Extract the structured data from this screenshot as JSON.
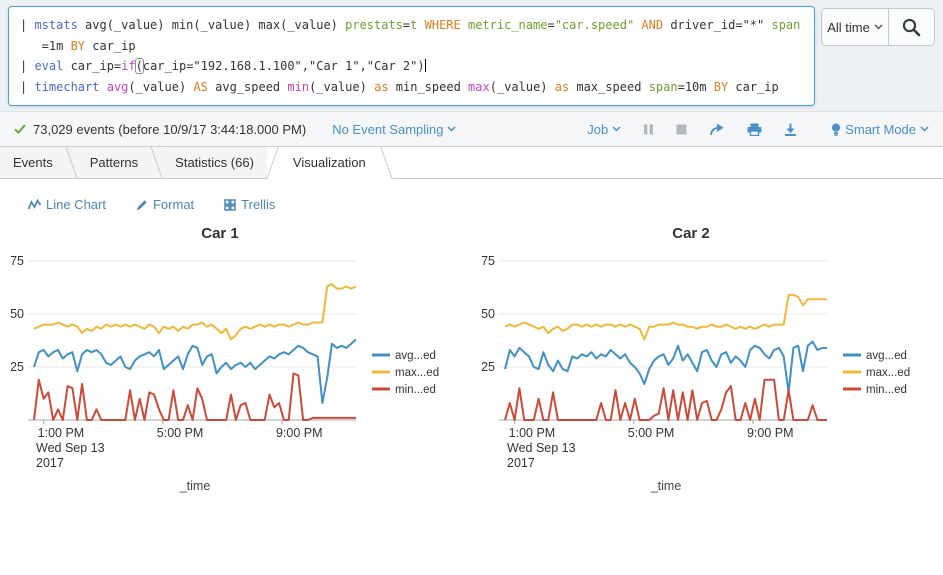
{
  "search": {
    "time_range_label": "All time",
    "query_lines": [
      [
        {
          "t": "| "
        },
        {
          "t": "mstats",
          "c": "cmd"
        },
        {
          "t": " avg(_value) min(_value) max(_value) "
        },
        {
          "t": "prestats",
          "c": "arg"
        },
        {
          "t": "="
        },
        {
          "t": "t",
          "c": "arg"
        },
        {
          "t": " "
        },
        {
          "t": "WHERE",
          "c": "kw"
        },
        {
          "t": " "
        },
        {
          "t": "metric_name",
          "c": "arg"
        },
        {
          "t": "="
        },
        {
          "t": "\"car.speed\"",
          "c": "arg"
        },
        {
          "t": " "
        },
        {
          "t": "AND",
          "c": "kw"
        },
        {
          "t": " driver_id=\"*\" "
        },
        {
          "t": "span",
          "c": "arg"
        }
      ],
      [
        {
          "t": "   =1m "
        },
        {
          "t": "BY",
          "c": "kw"
        },
        {
          "t": " car_ip"
        }
      ],
      [
        {
          "t": "| "
        },
        {
          "t": "eval",
          "c": "cmd"
        },
        {
          "t": " car_ip="
        },
        {
          "t": "if",
          "c": "fn"
        },
        {
          "t": "(",
          "c": "br"
        },
        {
          "t": "car_ip=\"192.168.1.100\",\"Car 1\",\"Car 2\")"
        },
        {
          "t": "",
          "c": "cursor"
        }
      ],
      [
        {
          "t": "| "
        },
        {
          "t": "timechart",
          "c": "cmd"
        },
        {
          "t": " "
        },
        {
          "t": "avg",
          "c": "fn"
        },
        {
          "t": "(_value) "
        },
        {
          "t": "AS",
          "c": "kw"
        },
        {
          "t": " avg_speed "
        },
        {
          "t": "min",
          "c": "fn"
        },
        {
          "t": "(_value) "
        },
        {
          "t": "as",
          "c": "kw"
        },
        {
          "t": " min_speed "
        },
        {
          "t": "max",
          "c": "fn"
        },
        {
          "t": "(_value) "
        },
        {
          "t": "as",
          "c": "kw"
        },
        {
          "t": " max_speed "
        },
        {
          "t": "span",
          "c": "arg"
        },
        {
          "t": "=10m "
        },
        {
          "t": "BY",
          "c": "kw"
        },
        {
          "t": " car_ip"
        }
      ]
    ]
  },
  "status_bar": {
    "events_summary": "73,029 events (before 10/9/17 3:44:18.000 PM)",
    "sampling_label": "No Event Sampling",
    "job_label": "Job",
    "mode_label": "Smart Mode"
  },
  "tabs": [
    {
      "label": "Events"
    },
    {
      "label": "Patterns"
    },
    {
      "label": "Statistics (66)"
    },
    {
      "label": "Visualization",
      "active": true
    }
  ],
  "viz_toolbar": {
    "chart_type_label": "Line Chart",
    "format_label": "Format",
    "trellis_label": "Trellis"
  },
  "icons": {
    "check": "checkmark",
    "chevron": "chevron-down",
    "pause": "pause",
    "stop": "stop",
    "share": "share-arrow",
    "print": "printer",
    "export": "download",
    "bulb": "lightbulb",
    "magnifier": "search",
    "line_chart": "zigzag-line",
    "pencil": "pencil",
    "trellis": "grid-2x2"
  },
  "colors": {
    "link_blue": "#4a90c9",
    "toolbar_blue": "#4a87b4",
    "check_green": "#65a637",
    "disabled_gray": "#b4b9bd",
    "searchbox_border": "#4f9fd8",
    "syntax_command": "#4a6bc4",
    "syntax_function": "#c743c7",
    "syntax_keyword": "#e07b1f",
    "syntax_argument": "#6ca02e"
  },
  "chart_data": [
    {
      "type": "line",
      "title": "Car 1",
      "xlabel": "_time",
      "ylim": [
        0,
        80
      ],
      "yticks": [
        25,
        50,
        75
      ],
      "xticks": [
        {
          "label": "1:00 PM",
          "f": 0.03
        },
        {
          "label": "5:00 PM",
          "f": 0.4
        },
        {
          "label": "9:00 PM",
          "f": 0.77
        }
      ],
      "date_lines": [
        "Wed Sep 13",
        "2017"
      ],
      "grid": true,
      "legend_position": "right",
      "series": [
        {
          "name": "avg...ed",
          "color": "#4090c4",
          "values": [
            25,
            32,
            33,
            30,
            32,
            33,
            29,
            31,
            32,
            23,
            31,
            33,
            32,
            33,
            31,
            27,
            26,
            28,
            30,
            25,
            24,
            28,
            30,
            31,
            32,
            30,
            33,
            24,
            26,
            28,
            30,
            24,
            31,
            35,
            34,
            26,
            30,
            31,
            22,
            25,
            27,
            24,
            26,
            27,
            25,
            27,
            24,
            26,
            28,
            30,
            29,
            31,
            32,
            31,
            33,
            35,
            34,
            32,
            31,
            30,
            8,
            20,
            36,
            34,
            35,
            34,
            36,
            38
          ]
        },
        {
          "name": "max...ed",
          "color": "#f0b839",
          "values": [
            43,
            44,
            45,
            45,
            45,
            46,
            45,
            44,
            45,
            44,
            41,
            43,
            42,
            44,
            43,
            45,
            44,
            45,
            44,
            45,
            44,
            45,
            44,
            43,
            45,
            44,
            41,
            44,
            43,
            44,
            42,
            44,
            43,
            45,
            45,
            46,
            44,
            45,
            43,
            41,
            43,
            38,
            40,
            43,
            44,
            43,
            44,
            45,
            44,
            45,
            44,
            45,
            45,
            44,
            45,
            46,
            45,
            45,
            46,
            46,
            46,
            63,
            64,
            62,
            62,
            63,
            62,
            63
          ]
        },
        {
          "name": "min...ed",
          "color": "#cb4a38",
          "values": [
            0,
            19,
            10,
            13,
            0,
            5,
            0,
            16,
            15,
            0,
            17,
            0,
            0,
            5,
            0,
            0,
            0,
            0,
            0,
            0,
            14,
            0,
            10,
            0,
            13,
            12,
            5,
            0,
            0,
            14,
            0,
            0,
            7,
            0,
            15,
            10,
            0,
            0,
            0,
            0,
            0,
            12,
            0,
            7,
            8,
            0,
            0,
            0,
            0,
            12,
            6,
            8,
            0,
            0,
            22,
            21,
            0,
            0,
            1,
            1,
            1,
            1,
            1,
            1,
            1,
            1,
            1,
            1
          ]
        }
      ]
    },
    {
      "type": "line",
      "title": "Car 2",
      "xlabel": "_time",
      "ylim": [
        0,
        80
      ],
      "yticks": [
        25,
        50,
        75
      ],
      "xticks": [
        {
          "label": "1:00 PM",
          "f": 0.03
        },
        {
          "label": "5:00 PM",
          "f": 0.4
        },
        {
          "label": "9:00 PM",
          "f": 0.77
        }
      ],
      "date_lines": [
        "Wed Sep 13",
        "2017"
      ],
      "grid": true,
      "legend_position": "right",
      "series": [
        {
          "name": "avg...ed",
          "color": "#4090c4",
          "values": [
            24,
            33,
            30,
            34,
            32,
            30,
            25,
            24,
            32,
            26,
            23,
            28,
            24,
            23,
            30,
            29,
            31,
            30,
            32,
            29,
            31,
            30,
            33,
            31,
            29,
            31,
            27,
            25,
            22,
            17,
            24,
            28,
            30,
            31,
            26,
            29,
            35,
            28,
            31,
            27,
            23,
            32,
            33,
            28,
            25,
            31,
            32,
            27,
            30,
            28,
            25,
            33,
            35,
            34,
            31,
            29,
            33,
            34,
            30,
            13,
            34,
            35,
            23,
            35,
            37,
            33,
            34,
            34
          ]
        },
        {
          "name": "max...ed",
          "color": "#f0b839",
          "values": [
            44,
            45,
            44,
            45,
            46,
            45,
            44,
            43,
            44,
            41,
            43,
            44,
            42,
            43,
            45,
            45,
            44,
            45,
            44,
            45,
            44,
            45,
            45,
            44,
            45,
            44,
            45,
            44,
            43,
            38,
            44,
            44,
            45,
            45,
            45,
            46,
            45,
            45,
            44,
            44,
            43,
            44,
            44,
            45,
            44,
            44,
            45,
            44,
            43,
            44,
            43,
            44,
            43,
            44,
            45,
            44,
            45,
            45,
            45,
            59,
            59,
            58,
            54,
            57,
            57,
            57,
            57,
            57
          ]
        },
        {
          "name": "min...ed",
          "color": "#cb4a38",
          "values": [
            0,
            8,
            0,
            15,
            0,
            0,
            0,
            10,
            0,
            0,
            13,
            0,
            0,
            0,
            0,
            0,
            0,
            0,
            0,
            0,
            8,
            0,
            0,
            14,
            0,
            8,
            0,
            10,
            0,
            0,
            0,
            2,
            3,
            15,
            0,
            14,
            0,
            13,
            0,
            14,
            0,
            8,
            9,
            0,
            0,
            5,
            13,
            16,
            0,
            0,
            8,
            0,
            10,
            0,
            19,
            19,
            19,
            0,
            0,
            14,
            0,
            0,
            0,
            0,
            7,
            0,
            0,
            0
          ]
        }
      ]
    }
  ]
}
